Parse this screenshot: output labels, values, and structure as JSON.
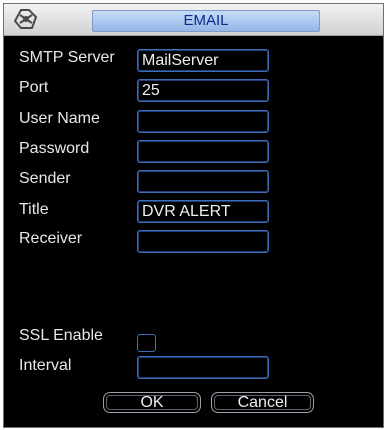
{
  "window": {
    "title": "EMAIL",
    "logo_icon": "dvr-logo-icon"
  },
  "form": {
    "smtp_server": {
      "label": "SMTP Server",
      "value": "MailServer"
    },
    "port": {
      "label": "Port",
      "value": "25"
    },
    "user_name": {
      "label": "User Name",
      "value": ""
    },
    "password": {
      "label": "Password",
      "value": ""
    },
    "sender": {
      "label": "Sender",
      "value": ""
    },
    "title": {
      "label": "Title",
      "value": "DVR ALERT"
    },
    "receiver": {
      "label": "Receiver",
      "value": ""
    },
    "ssl_enable": {
      "label": "SSL Enable",
      "checked": false
    },
    "interval": {
      "label": "Interval",
      "value": ""
    }
  },
  "buttons": {
    "ok": "OK",
    "cancel": "Cancel"
  },
  "colors": {
    "background": "#000000",
    "field_border": "#3f6db3",
    "title_text": "#0a2a8c"
  }
}
